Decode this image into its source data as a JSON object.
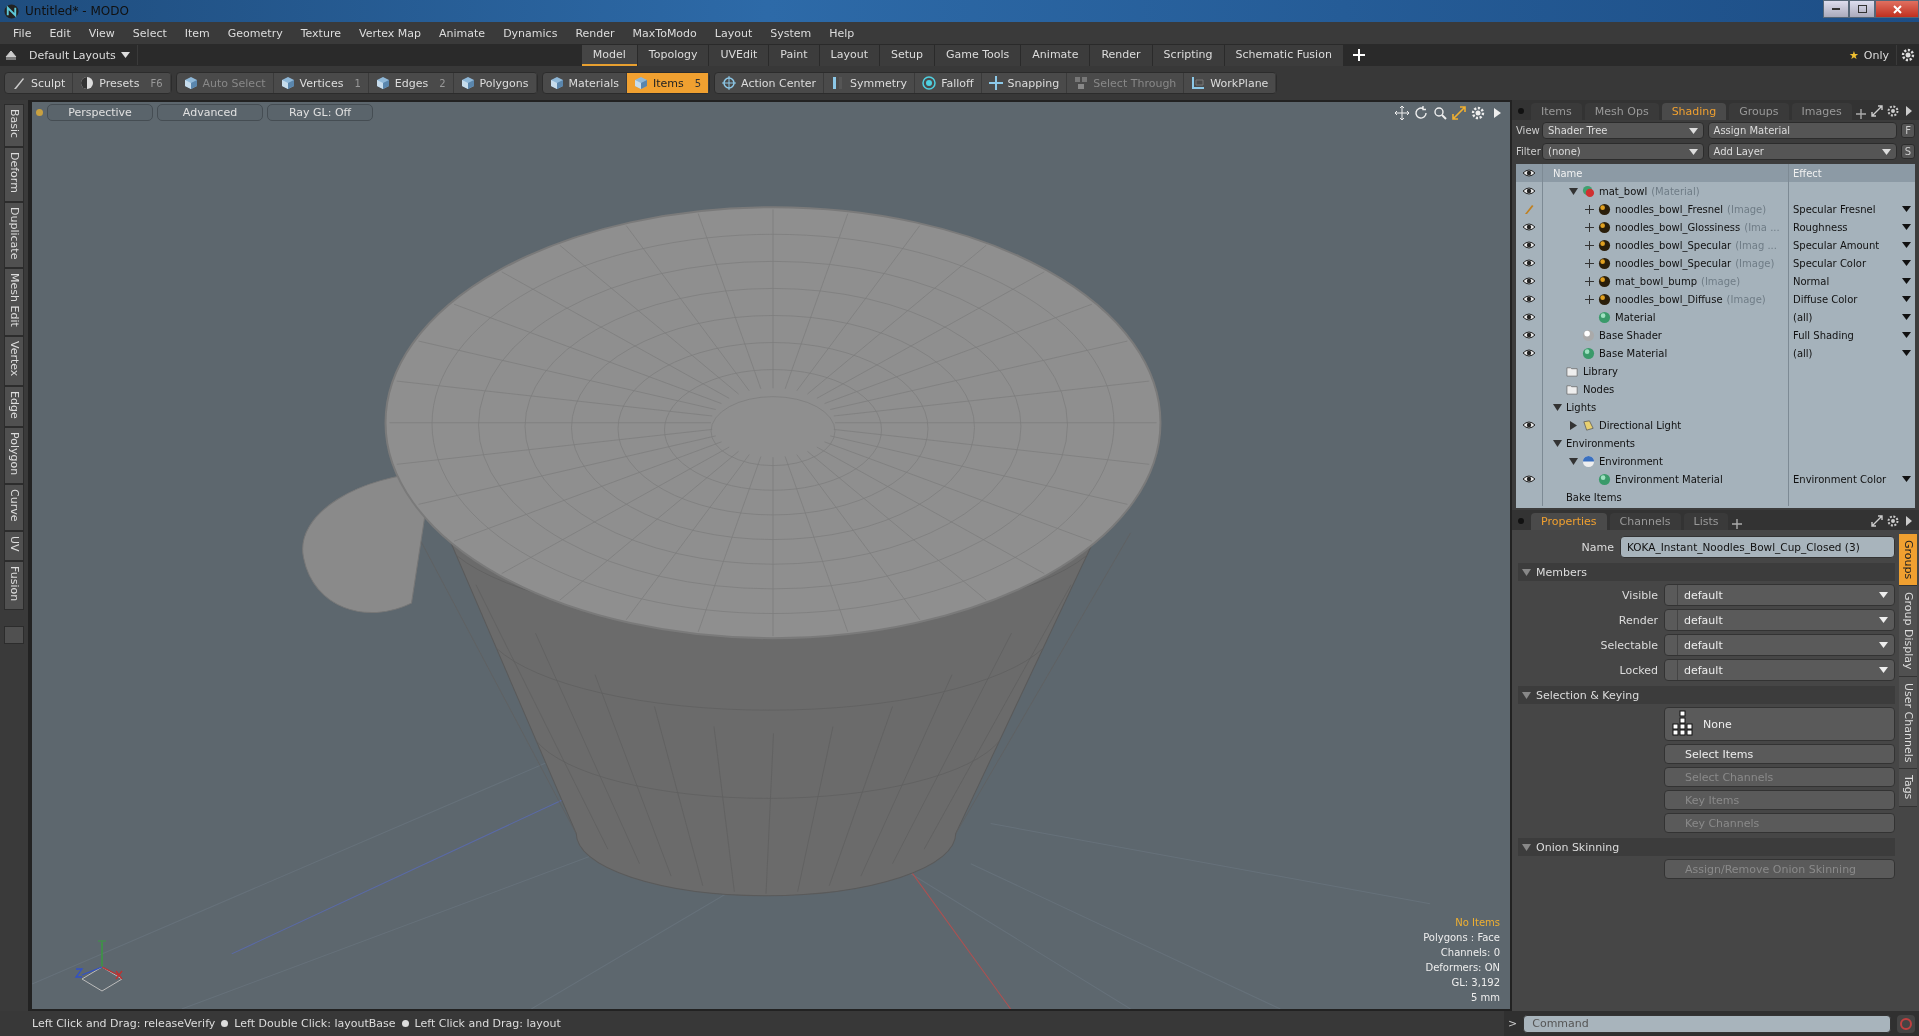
{
  "window": {
    "title": "Untitled* - MODO"
  },
  "menu": [
    "File",
    "Edit",
    "View",
    "Select",
    "Item",
    "Geometry",
    "Texture",
    "Vertex Map",
    "Animate",
    "Dynamics",
    "Render",
    "MaxToModo",
    "Layout",
    "System",
    "Help"
  ],
  "layout_bar": {
    "layout_menu": "Default Layouts",
    "tabs": [
      {
        "label": "Model",
        "selected": true
      },
      {
        "label": "Topology",
        "selected": false
      },
      {
        "label": "UVEdit",
        "selected": false
      },
      {
        "label": "Paint",
        "selected": false
      },
      {
        "label": "Layout",
        "selected": false
      },
      {
        "label": "Setup",
        "selected": false
      },
      {
        "label": "Game Tools",
        "selected": false
      },
      {
        "label": "Animate",
        "selected": false
      },
      {
        "label": "Render",
        "selected": false
      },
      {
        "label": "Scripting",
        "selected": false
      },
      {
        "label": "Schematic Fusion",
        "selected": false
      }
    ],
    "only_icon": "★",
    "only": "Only"
  },
  "toolbar": [
    [
      {
        "label": "Sculpt",
        "kind": "brush",
        "disabled": false
      },
      {
        "label": "Presets",
        "shortcut": "F6",
        "kind": "presets",
        "disabled": false
      }
    ],
    [
      {
        "label": "Auto Select",
        "kind": "cube",
        "disabled": true,
        "selected": false
      },
      {
        "label": "Vertices",
        "shortcut": "1",
        "kind": "cube",
        "disabled": false,
        "selected": false
      },
      {
        "label": "Edges",
        "shortcut": "2",
        "kind": "cube",
        "disabled": false,
        "selected": false
      },
      {
        "label": "Polygons",
        "kind": "cube",
        "disabled": false,
        "selected": false
      }
    ],
    [
      {
        "label": "Materials",
        "kind": "cube",
        "disabled": false,
        "selected": false
      },
      {
        "label": "Items",
        "shortcut": "5",
        "kind": "cube",
        "disabled": false,
        "selected": true
      }
    ],
    [
      {
        "label": "Action Center",
        "kind": "crosshair",
        "disabled": false
      },
      {
        "label": "Symmetry",
        "kind": "symmetry",
        "disabled": false
      },
      {
        "label": "Falloff",
        "kind": "falloff",
        "disabled": false
      },
      {
        "label": "Snapping",
        "kind": "snap",
        "disabled": false
      },
      {
        "label": "Select Through",
        "kind": "through",
        "disabled": true
      },
      {
        "label": "WorkPlane",
        "kind": "workplane",
        "disabled": false
      }
    ]
  ],
  "left_tabs": [
    "Basic",
    "Deform",
    "Duplicate",
    "Mesh Edit",
    "Vertex",
    "Edge",
    "Polygon",
    "Curve",
    "UV",
    "Fusion"
  ],
  "viewport": {
    "header": [
      "Perspective",
      "Advanced",
      "Ray GL: Off"
    ],
    "info": {
      "selection": "No Items",
      "lines": [
        "Polygons : Face",
        "Channels: 0",
        "Deformers: ON",
        "GL: 3,192",
        "5 mm"
      ]
    }
  },
  "shading_panel": {
    "tabs": [
      {
        "label": "Items",
        "selected": false
      },
      {
        "label": "Mesh Ops",
        "selected": false
      },
      {
        "label": "Shading",
        "selected": true
      },
      {
        "label": "Groups",
        "selected": false
      },
      {
        "label": "Images",
        "selected": false
      }
    ],
    "view_label": "View",
    "view_value": "Shader Tree",
    "assign": "Assign Material",
    "f_button": "F",
    "filter_label": "Filter",
    "filter_value": "(none)",
    "add_layer": "Add Layer",
    "s_button": "S",
    "columns": [
      "Name",
      "Effect"
    ],
    "tree": {
      "continued_children": [
        {
          "name": "mat_bowl",
          "type_label": "(Material)",
          "kind": "material-group",
          "visible": true,
          "expanded": true,
          "children": [
            {
              "name": "noodles_bowl_Fresnel",
              "type_label": "(Image)",
              "effect": "Specular Fresnel",
              "kind": "paint-image",
              "visible": true,
              "expanded": false
            },
            {
              "name": "noodles_bowl_Glossiness",
              "type_label": "(Ima ...",
              "effect": "Roughness",
              "kind": "image",
              "visible": true,
              "expanded": false
            },
            {
              "name": "noodles_bowl_Specular",
              "type_label": "(Imag ...",
              "effect": "Specular Amount",
              "kind": "image",
              "visible": true,
              "expanded": false
            },
            {
              "name": "noodles_bowl_Specular",
              "type_label": "(Image)",
              "effect": "Specular Color",
              "kind": "image",
              "visible": true,
              "expanded": false
            },
            {
              "name": "mat_bowl_bump",
              "type_label": "(Image)",
              "effect": "Normal",
              "kind": "image",
              "visible": true,
              "expanded": false
            },
            {
              "name": "noodles_bowl_Diffuse",
              "type_label": "(Image)",
              "effect": "Diffuse Color",
              "kind": "image",
              "visible": true,
              "expanded": false
            },
            {
              "name": "Material",
              "effect": "(all)",
              "kind": "material",
              "visible": true
            }
          ]
        },
        {
          "name": "Base Shader",
          "effect": "Full Shading",
          "kind": "shader",
          "visible": true
        },
        {
          "name": "Base Material",
          "effect": "(all)",
          "kind": "material",
          "visible": true
        }
      ],
      "items": [
        {
          "name": "Library",
          "kind": "folder",
          "visible": false
        },
        {
          "name": "Nodes",
          "kind": "folder",
          "visible": false
        },
        {
          "name": "Lights",
          "kind": "group",
          "visible": false,
          "expanded": true,
          "children": [
            {
              "name": "Directional Light",
              "kind": "light",
              "visible": true,
              "expanded": false
            }
          ]
        },
        {
          "name": "Environments",
          "kind": "group",
          "visible": false,
          "expanded": true,
          "children": [
            {
              "name": "Environment",
              "kind": "environment",
              "visible": false,
              "expanded": true,
              "children": [
                {
                  "name": "Environment Material",
                  "effect": "Environment Color",
                  "kind": "material",
                  "visible": true
                }
              ]
            }
          ]
        },
        {
          "name": "Bake Items",
          "kind": "group",
          "visible": false
        }
      ]
    }
  },
  "properties_panel": {
    "tabs": [
      {
        "label": "Properties",
        "selected": true
      },
      {
        "label": "Channels",
        "selected": false
      },
      {
        "label": "Lists",
        "selected": false
      }
    ],
    "name_label": "Name",
    "name_value": "KOKA_Instant_Noodles_Bowl_Cup_Closed (3)",
    "sections": [
      {
        "title": "Members",
        "kind": "fields",
        "expanded": true,
        "fields": [
          {
            "label": "Visible",
            "value": "default"
          },
          {
            "label": "Render",
            "value": "default"
          },
          {
            "label": "Selectable",
            "value": "default"
          },
          {
            "label": "Locked",
            "value": "default"
          }
        ]
      },
      {
        "title": "Selection & Keying",
        "kind": "buttons",
        "expanded": true,
        "preset": "None",
        "buttons": [
          {
            "label": "Select Items",
            "disabled": false
          },
          {
            "label": "Select Channels",
            "disabled": true
          },
          {
            "label": "Key Items",
            "disabled": true
          },
          {
            "label": "Key Channels",
            "disabled": true
          }
        ]
      },
      {
        "title": "Onion Skinning",
        "kind": "buttons",
        "expanded": true,
        "buttons": [
          {
            "label": "Assign/Remove Onion Skinning",
            "disabled": true
          }
        ]
      }
    ],
    "side_tabs": [
      {
        "label": "Groups",
        "selected": true
      },
      {
        "label": "Group Display",
        "selected": false
      },
      {
        "label": "User Channels",
        "selected": false
      },
      {
        "label": "Tags",
        "selected": false
      }
    ]
  },
  "status_bar": {
    "hints": [
      "Left Click and Drag: releaseVerify",
      "Left Double Click: layoutBase",
      "Left Click and Drag: layout"
    ]
  },
  "command": {
    "prompt": ">",
    "placeholder": "Command"
  }
}
